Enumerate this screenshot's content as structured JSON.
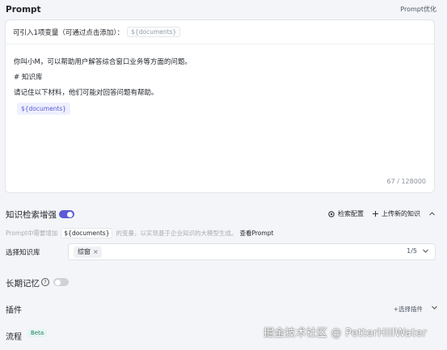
{
  "prompt": {
    "title": "Prompt",
    "optimize_label": "Prompt优化",
    "variable_hint": "可引入1项变量（可通过点击添加）：",
    "variable_chip": "${documents}",
    "lines": [
      "你叫小M，可以帮助用户解答综合窗口业务等方面的问题。",
      "# 知识库",
      "请记住以下材料，他们可能对回答问题有帮助。"
    ],
    "doc_chip": "${documents}",
    "char_count": "67 / 128000"
  },
  "knowledge": {
    "title": "知识检索增强",
    "enabled": true,
    "config_label": "检索配置",
    "upload_label": "上传新的知识",
    "hint_prefix": "Prompt中需要增加",
    "hint_code": "${documents}",
    "hint_suffix": "的变量，以实现基于企业知识的大模型生成。",
    "hint_link": "查看Prompt",
    "select_label": "选择知识库",
    "selected_tag": "综窗",
    "selected_count": "1/5"
  },
  "memory": {
    "title": "长期记忆",
    "help_glyph": "?",
    "enabled": false
  },
  "plugins": {
    "title": "插件",
    "add_label": "+选择插件"
  },
  "flow": {
    "title": "流程",
    "badge": "Beta"
  },
  "watermark": "掘金技术社区 @ PetterHillWater",
  "colors": {
    "accent": "#5b5bd6",
    "beta_bg": "#e4f6f1",
    "beta_text": "#1f7a62"
  }
}
